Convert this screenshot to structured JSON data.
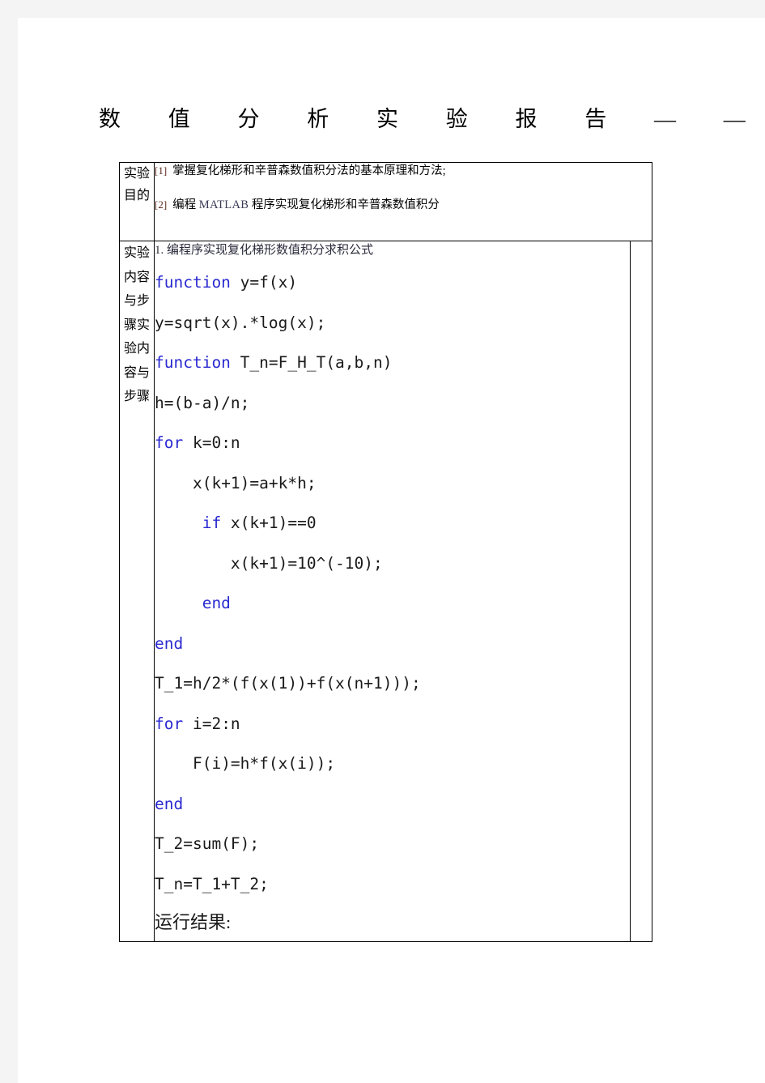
{
  "document": {
    "title": "数 值 分 析 实 验 报 告 — —"
  },
  "table": {
    "rows": [
      {
        "label": "实验目的",
        "objectives": [
          {
            "marker": "[1]",
            "text_before": "掌握复化梯形和辛普森数值积分法的基本原理和方法;",
            "keyword": "",
            "text_after": ""
          },
          {
            "marker": "[2]",
            "text_before": "编程 ",
            "keyword": "MATLAB",
            "text_after": " 程序实现复化梯形和辛普森数值积分"
          }
        ]
      },
      {
        "label": "实验内容与步骤实验内容与步骤",
        "heading": "1. 编程序实现复化梯形数值积分求积公式",
        "code": [
          {
            "keyword": "function",
            "rest": " y=f(x)",
            "indent": ""
          },
          {
            "keyword": "",
            "rest": "y=sqrt(x).*log(x);",
            "indent": ""
          },
          {
            "keyword": "function",
            "rest": " T_n=F_H_T(a,b,n)",
            "indent": ""
          },
          {
            "keyword": "",
            "rest": "h=(b-a)/n;",
            "indent": ""
          },
          {
            "keyword": "for",
            "rest": " k=0:n",
            "indent": ""
          },
          {
            "keyword": "",
            "rest": "x(k+1)=a+k*h;",
            "indent": "    "
          },
          {
            "keyword": "if",
            "rest": " x(k+1)==0",
            "indent": "     "
          },
          {
            "keyword": "",
            "rest": "x(k+1)=10^(-10);",
            "indent": "        "
          },
          {
            "keyword": "end",
            "rest": "",
            "indent": "     "
          },
          {
            "keyword": "end",
            "rest": "",
            "indent": ""
          },
          {
            "keyword": "",
            "rest": "T_1=h/2*(f(x(1))+f(x(n+1)));",
            "indent": ""
          },
          {
            "keyword": "for",
            "rest": " i=2:n",
            "indent": ""
          },
          {
            "keyword": "",
            "rest": "F(i)=h*f(x(i));",
            "indent": "    "
          },
          {
            "keyword": "end",
            "rest": "",
            "indent": ""
          },
          {
            "keyword": "",
            "rest": "T_2=sum(F);",
            "indent": ""
          },
          {
            "keyword": "",
            "rest": "T_n=T_1+T_2;",
            "indent": ""
          }
        ],
        "result_label": "运行结果:"
      }
    ]
  },
  "colors": {
    "keyword": "#2a2ad0",
    "marker": "#5c2a1e",
    "border": "#000000",
    "page_background": "#ffffff",
    "canvas_background": "#f4f4f4"
  }
}
